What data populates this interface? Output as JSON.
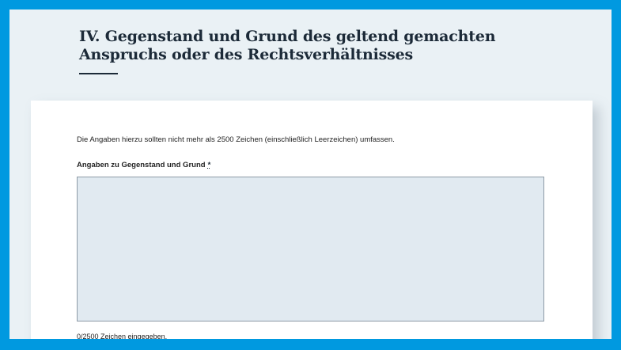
{
  "section": {
    "title": "IV. Gegenstand und Grund des geltend gemachten Anspruchs oder des Rechtsverhältnisses"
  },
  "form": {
    "hint": "Die Angaben hierzu sollten nicht mehr als 2500 Zeichen (einschließlich Leerzeichen) umfassen.",
    "field_label": "Angaben zu Gegenstand und Grund",
    "required_marker": "*",
    "textarea_value": "",
    "char_counter": "0/2500 Zeichen eingegeben."
  },
  "colors": {
    "frame_border": "#0099e0",
    "page_background": "#eaf1f5",
    "card_background": "#ffffff",
    "textarea_background": "#e1eaf1",
    "heading_text": "#1c2a38"
  }
}
